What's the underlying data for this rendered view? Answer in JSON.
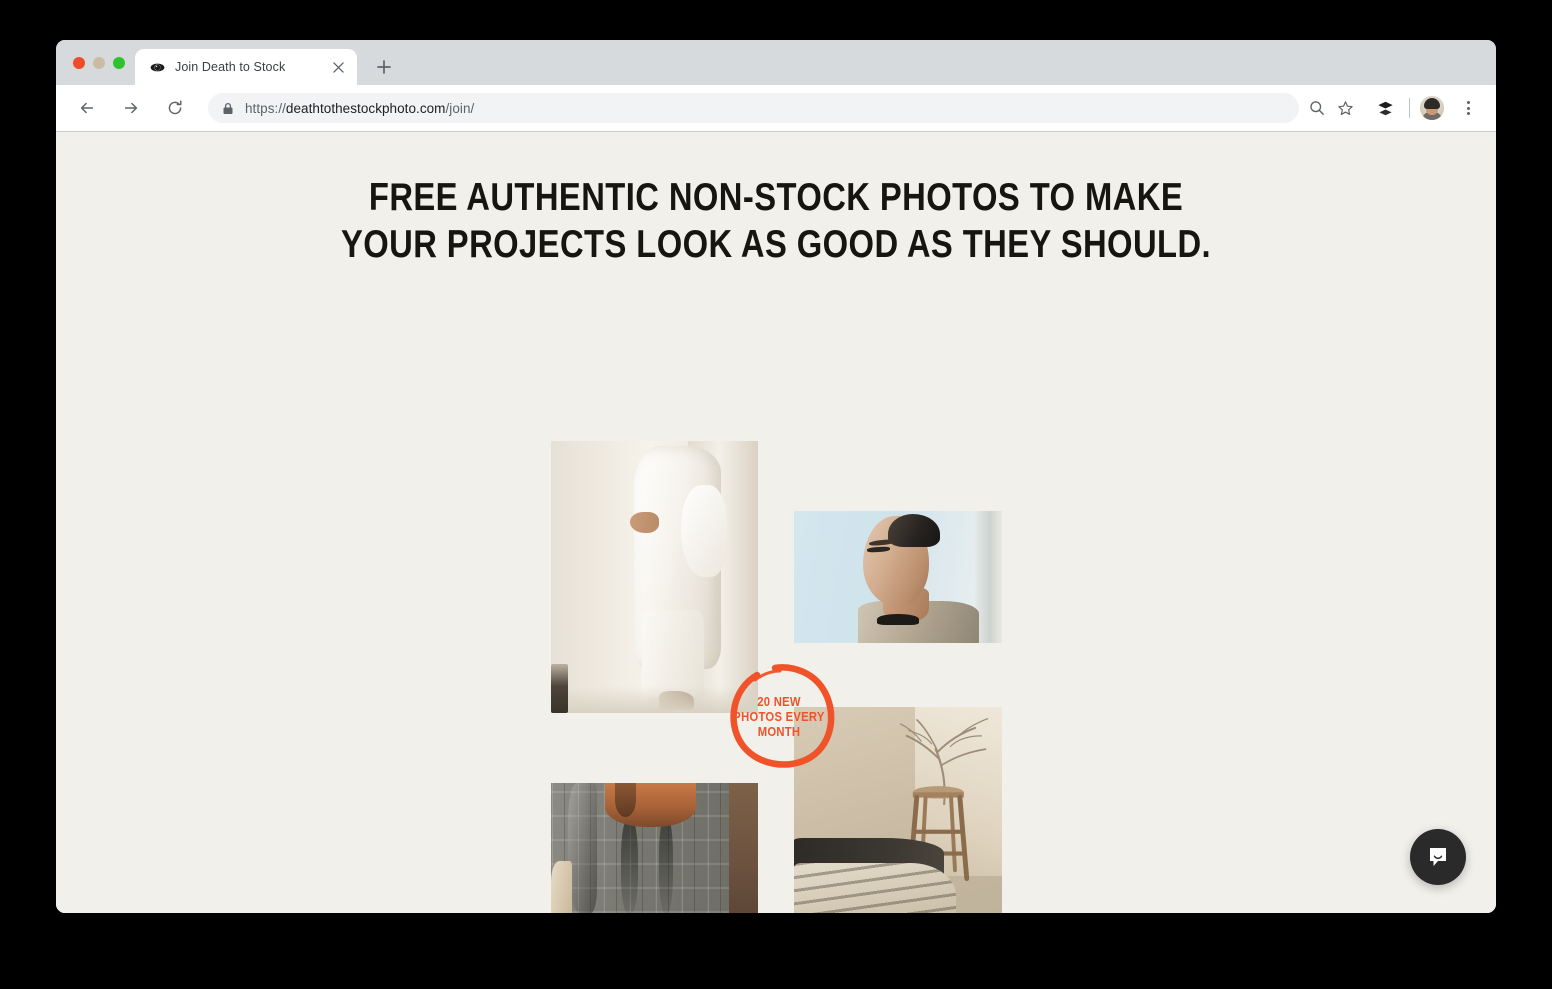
{
  "window": {
    "traffic_lights": [
      "close",
      "minimize",
      "zoom"
    ]
  },
  "browser": {
    "tab": {
      "title": "Join Death to Stock",
      "favicon": "eye-icon",
      "close_label": "×"
    },
    "new_tab_label": "+",
    "nav": {
      "back": "←",
      "forward": "→",
      "reload": "↻"
    },
    "omnibox": {
      "lock": "lock-icon",
      "url_scheme": "https://",
      "url_host": "deathtothestockphoto.com",
      "url_path": "/join/"
    },
    "toolbar_icons": [
      {
        "name": "zoom-search-icon",
        "glyph": "⚲"
      },
      {
        "name": "bookmark-star-icon",
        "glyph": "☆"
      },
      {
        "name": "buffer-extension-icon",
        "glyph": "≡"
      },
      {
        "name": "profile-avatar",
        "glyph": ""
      },
      {
        "name": "chrome-menu-icon",
        "glyph": "⋮"
      }
    ]
  },
  "page": {
    "background_color": "#f2f0eb",
    "headline": {
      "line1": "Free authentic non-stock photos to make",
      "line2": "your projects look as good as they should."
    },
    "badge": {
      "line1": "20 New",
      "line2": "Photos Every",
      "line3": "Month",
      "color": "#f0522a"
    },
    "photos": [
      {
        "name": "photo-white-outfit",
        "alt": "Person in white linen outfit against pale backdrop"
      },
      {
        "name": "photo-portrait-man",
        "alt": "Portrait of man looking down, pale blue background"
      },
      {
        "name": "photo-plaid-coat",
        "alt": "Gray plaid coat detail with auburn hair"
      },
      {
        "name": "photo-bedroom-stool",
        "alt": "Bed with striped blanket, wooden stool and bare tree"
      }
    ],
    "chat": {
      "name": "intercom-launcher",
      "label": "Open chat"
    }
  }
}
